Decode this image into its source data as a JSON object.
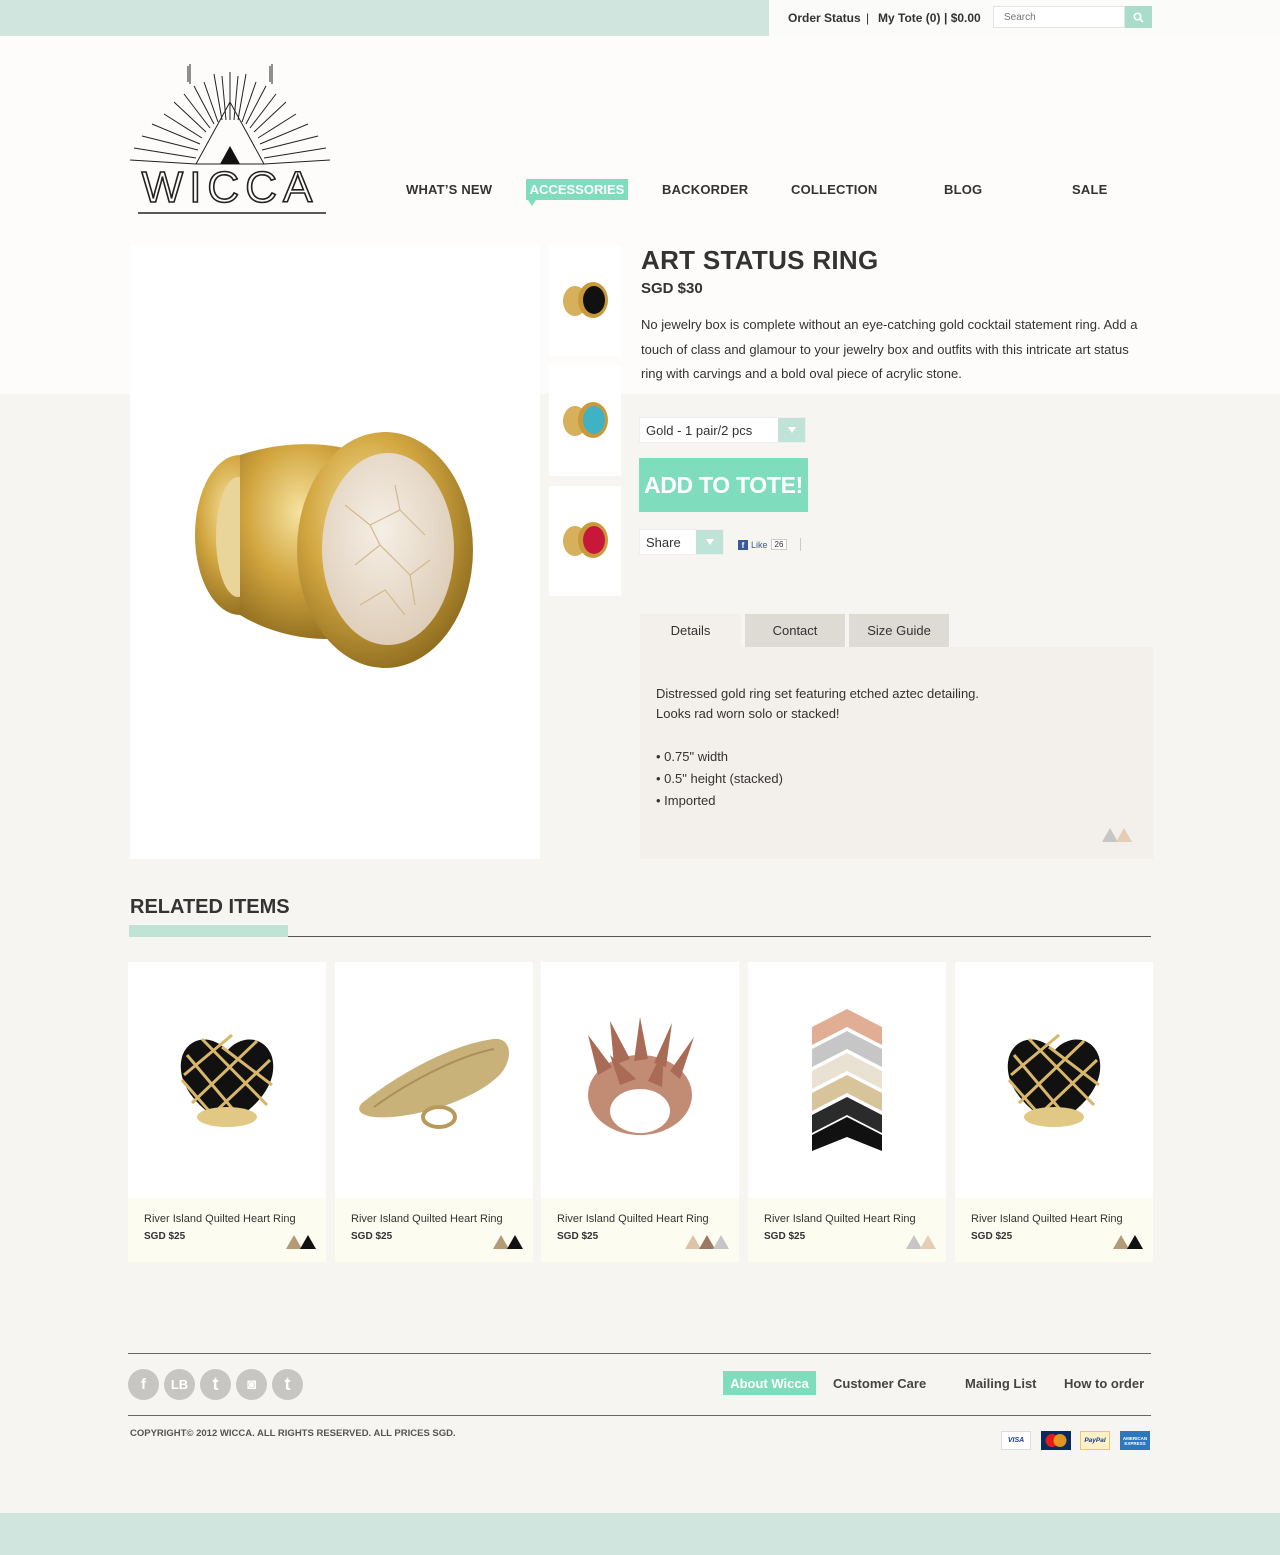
{
  "topbar": {
    "order_status": "Order Status",
    "separator": "|",
    "my_tote": "My Tote (0)",
    "tote_total": "| $0.00",
    "search_placeholder": "Search"
  },
  "logo": {
    "text": "WICCA"
  },
  "nav": {
    "whats_new": "WHAT’S NEW",
    "accessories": "ACCESSORIES",
    "backorder": "BACKORDER",
    "collection": "COLLECTION",
    "blog": "BLOG",
    "sale": "SALE"
  },
  "product": {
    "title": "ART STATUS RING",
    "price": "SGD $30",
    "description": "No jewelry box is complete without an eye-catching gold cocktail statement ring. Add a touch of class and glamour to your jewelry box and outfits with this intricate art status ring with carvings and a bold oval piece of acrylic stone.",
    "variant": "Gold - 1 pair/2 pcs",
    "add_to_tote": "ADD TO TOTE!",
    "share": "Share",
    "fb_like": "Like",
    "fb_count": "26",
    "thumbnails": [
      "black-stone-ring-thumb",
      "turquoise-stone-ring-thumb",
      "red-stone-ring-thumb"
    ]
  },
  "tabs": {
    "details": "Details",
    "contact": "Contact",
    "size_guide": "Size Guide",
    "panel": {
      "line1": "Distressed gold ring set featuring etched aztec detailing.",
      "line2": "Looks rad worn solo or stacked!",
      "bullets": [
        "• 0.75\" width",
        "• 0.5\" height (stacked)",
        "• Imported"
      ]
    }
  },
  "related": {
    "title": "RELATED ITEMS",
    "items": [
      {
        "name": "River Island Quilted Heart Ring",
        "price": "SGD $25",
        "swatches": [
          "#b29b76",
          "#111111"
        ]
      },
      {
        "name": "River Island Quilted Heart Ring",
        "price": "SGD $25",
        "swatches": [
          "#b29b76",
          "#111111"
        ]
      },
      {
        "name": "River Island Quilted Heart Ring",
        "price": "SGD $25",
        "swatches": [
          "#dcc3a9",
          "#9a7a63",
          "#c6c6c6"
        ]
      },
      {
        "name": "River Island Quilted Heart Ring",
        "price": "SGD $25",
        "swatches": [
          "#c6c6c6",
          "#e5cdb6"
        ]
      },
      {
        "name": "River Island Quilted Heart Ring",
        "price": "SGD $25",
        "swatches": [
          "#b29b76",
          "#111111"
        ]
      }
    ]
  },
  "footer": {
    "social": {
      "facebook": "f",
      "lookbook": "LB",
      "tumblr": "t",
      "instagram": "◙",
      "twitter": "t"
    },
    "links": {
      "about": "About Wicca",
      "customer_care": "Customer Care",
      "mailing_list": "Mailing List",
      "how_to_order": "How to order"
    },
    "copyright": "COPYRIGHT© 2012 WICCA. ALL RIGHTS RESERVED. ALL PRICES SGD.",
    "payments": {
      "visa": "VISA",
      "mastercard": "MasterCard",
      "paypal": "PayPal",
      "amex": "AMERICAN EXPRESS"
    }
  },
  "colors": {
    "accent": "#7fdcbd",
    "mint_light": "#bfe3d6",
    "band": "#d0e5dd",
    "text": "#333333",
    "panel": "#f3efea"
  }
}
